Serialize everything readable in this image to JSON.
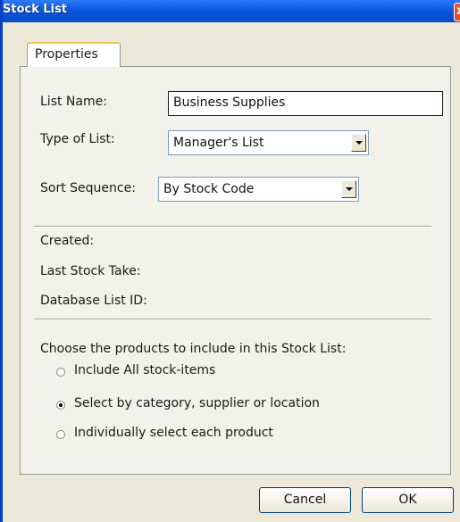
{
  "window": {
    "title": "Stock List",
    "close_glyph": "x"
  },
  "tabs": [
    {
      "label": "Properties"
    }
  ],
  "form": {
    "list_name_label": "List Name:",
    "list_name_value": "Business Supplies",
    "type_label": "Type of List:",
    "type_value": "Manager's List",
    "sort_label": "Sort Sequence:",
    "sort_value": "By Stock Code"
  },
  "info": {
    "created_label": "Created:",
    "last_stock_take_label": "Last Stock Take:",
    "database_id_label": "Database List ID:"
  },
  "products": {
    "heading": "Choose the products to include in this Stock List:",
    "options": [
      {
        "label": "Include All stock-items",
        "checked": false
      },
      {
        "label": "Select by category, supplier or location",
        "checked": true
      },
      {
        "label": "Individually select each product",
        "checked": false
      }
    ]
  },
  "buttons": {
    "cancel": "Cancel",
    "ok": "OK"
  },
  "colors": {
    "titlebar": "#0a57dd",
    "dialog_bg": "#ece9d8",
    "tab_highlight": "#f0c050"
  }
}
